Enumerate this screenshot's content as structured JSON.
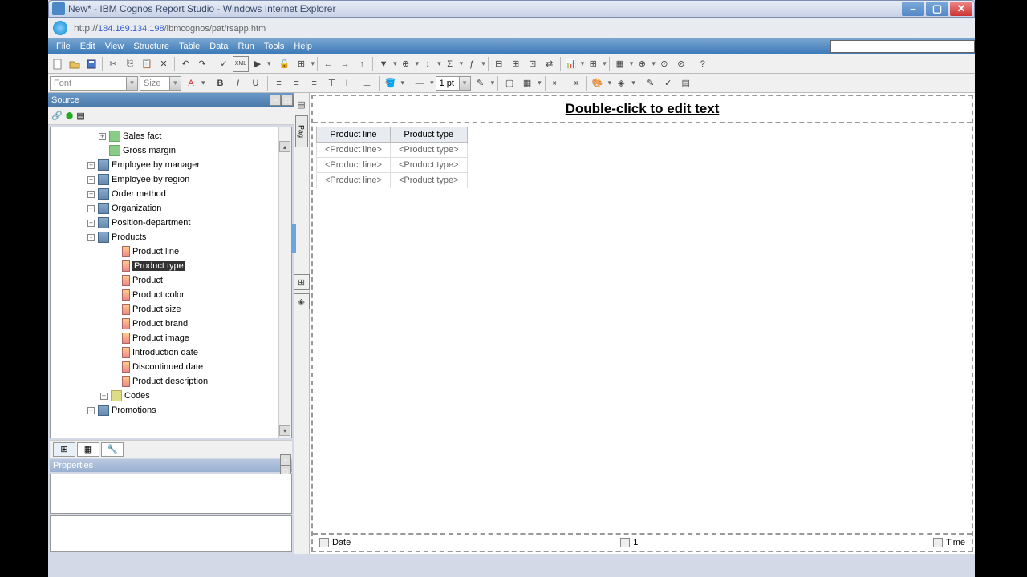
{
  "window": {
    "title": "New* - IBM Cognos Report Studio - Windows Internet Explorer",
    "url_host": "184.169.134.198",
    "url_path": "/ibmcognos/pat/rsapp.htm"
  },
  "menu": [
    "File",
    "Edit",
    "View",
    "Structure",
    "Table",
    "Data",
    "Run",
    "Tools",
    "Help"
  ],
  "format": {
    "font_ph": "Font",
    "size_ph": "Size",
    "line_width": "1 pt"
  },
  "source": {
    "title": "Source",
    "items": [
      {
        "indent": 60,
        "exp": "+",
        "icon": "calc",
        "label": "Sales fact"
      },
      {
        "indent": 60,
        "exp": "",
        "icon": "calc",
        "label": "Gross margin"
      },
      {
        "indent": 46,
        "exp": "+",
        "icon": "qsubj",
        "label": "Employee by manager"
      },
      {
        "indent": 46,
        "exp": "+",
        "icon": "qsubj",
        "label": "Employee by region"
      },
      {
        "indent": 46,
        "exp": "+",
        "icon": "qsubj",
        "label": "Order method"
      },
      {
        "indent": 46,
        "exp": "+",
        "icon": "qsubj",
        "label": "Organization"
      },
      {
        "indent": 46,
        "exp": "+",
        "icon": "qsubj",
        "label": "Position-department"
      },
      {
        "indent": 46,
        "exp": "-",
        "icon": "qsubj",
        "label": "Products"
      },
      {
        "indent": 76,
        "exp": "",
        "icon": "qitem",
        "label": "Product line"
      },
      {
        "indent": 76,
        "exp": "",
        "icon": "qitem",
        "label": "Product type",
        "selected": true
      },
      {
        "indent": 76,
        "exp": "",
        "icon": "qitem",
        "label": "Product",
        "hover": true
      },
      {
        "indent": 76,
        "exp": "",
        "icon": "qitem",
        "label": "Product color"
      },
      {
        "indent": 76,
        "exp": "",
        "icon": "qitem",
        "label": "Product size"
      },
      {
        "indent": 76,
        "exp": "",
        "icon": "qitem",
        "label": "Product brand"
      },
      {
        "indent": 76,
        "exp": "",
        "icon": "qitem",
        "label": "Product image"
      },
      {
        "indent": 76,
        "exp": "",
        "icon": "qitem",
        "label": "Introduction date"
      },
      {
        "indent": 76,
        "exp": "",
        "icon": "qitem",
        "label": "Discontinued date"
      },
      {
        "indent": 76,
        "exp": "",
        "icon": "qitem",
        "label": "Product description"
      },
      {
        "indent": 62,
        "exp": "+",
        "icon": "codes",
        "label": "Codes"
      },
      {
        "indent": 46,
        "exp": "+",
        "icon": "qsubj",
        "label": "Promotions"
      }
    ]
  },
  "props": {
    "title": "Properties"
  },
  "canvas": {
    "title_placeholder": "Double-click to edit text",
    "columns": [
      "Product line",
      "Product type"
    ],
    "rows": [
      [
        "<Product line>",
        "<Product type>"
      ],
      [
        "<Product line>",
        "<Product type>"
      ],
      [
        "<Product line>",
        "<Product type>"
      ]
    ],
    "page_tab": "Pag"
  },
  "footer": {
    "date": "Date",
    "page": "1",
    "time": "Time"
  }
}
